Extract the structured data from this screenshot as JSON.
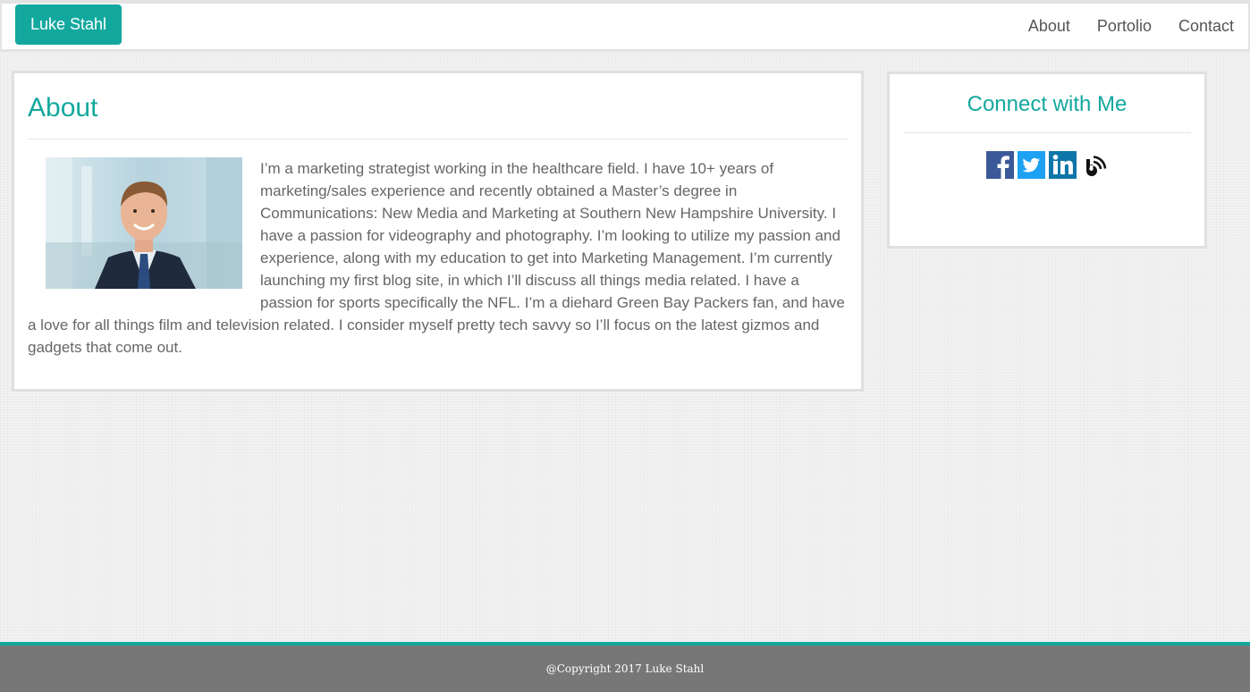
{
  "navbar": {
    "brand": "Luke Stahl",
    "links": [
      {
        "label": "About"
      },
      {
        "label": "Portolio"
      },
      {
        "label": "Contact"
      }
    ]
  },
  "about": {
    "title": "About",
    "body": "I’m a marketing strategist working in the healthcare field. I have 10+ years of marketing/sales experience and recently obtained a Master’s degree in Communications: New Media and Marketing at Southern New Hampshire University. I have a passion for videography and photography. I’m looking to utilize my passion and experience, along with my education to get into Marketing Management. I’m currently launching my first blog site, in which I’ll discuss all things media related. I have a passion for sports specifically the NFL. I’m a diehard Green Bay Packers fan, and have a love for all things film and television related. I consider myself pretty tech savvy so I’ll focus on the latest gizmos and gadgets that come out."
  },
  "connect": {
    "title": "Connect with Me",
    "icons": [
      "facebook-icon",
      "twitter-icon",
      "linkedin-icon",
      "blog-icon"
    ]
  },
  "footer": {
    "copyright": "@Copyright 2017 Luke Stahl"
  },
  "colors": {
    "accent": "#13a89e",
    "footer_bg": "#777777",
    "text": "#666666",
    "facebook": "#3b5998",
    "twitter": "#1da1f2",
    "linkedin": "#0e76a8"
  }
}
